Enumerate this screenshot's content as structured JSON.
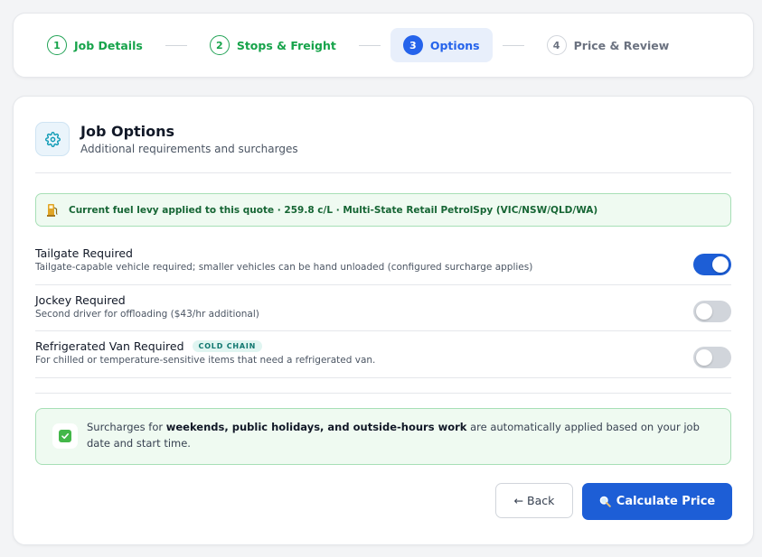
{
  "stepper": {
    "steps": [
      {
        "num": "1",
        "label": "Job Details",
        "state": "done"
      },
      {
        "num": "2",
        "label": "Stops & Freight",
        "state": "done"
      },
      {
        "num": "3",
        "label": "Options",
        "state": "active"
      },
      {
        "num": "4",
        "label": "Price & Review",
        "state": "todo"
      }
    ]
  },
  "card": {
    "icon": "gear-icon",
    "title": "Job Options",
    "subtitle": "Additional requirements and surcharges"
  },
  "fuel_banner": {
    "icon": "fuel-pump-icon",
    "text": "Current fuel levy applied to this quote · 259.8 c/L · Multi-State Retail PetrolSpy (VIC/NSW/QLD/WA)"
  },
  "options": [
    {
      "title": "Tailgate Required",
      "badge": "",
      "description": "Tailgate-capable vehicle required; smaller vehicles can be hand unloaded (configured surcharge applies)",
      "enabled": true
    },
    {
      "title": "Jockey Required",
      "badge": "",
      "description": "Second driver for offloading ($43/hr additional)",
      "enabled": false
    },
    {
      "title": "Refrigerated Van Required",
      "badge": "COLD CHAIN",
      "description": "For chilled or temperature-sensitive items that need a refrigerated van.",
      "enabled": false
    }
  ],
  "surcharge_notice": {
    "icon": "checkbox-checked-icon",
    "prefix": "Surcharges for ",
    "bold": "weekends, public holidays, and outside-hours work",
    "suffix": " are automatically applied based on your job date and start time."
  },
  "actions": {
    "back_label": "← Back",
    "calculate_label": "Calculate Price",
    "calculate_icon": "magnifier-icon"
  },
  "colors": {
    "accent": "#1d5ed6",
    "success": "#16a34a",
    "success_bg": "#effaf1",
    "toggle_off": "#d1d5db"
  }
}
